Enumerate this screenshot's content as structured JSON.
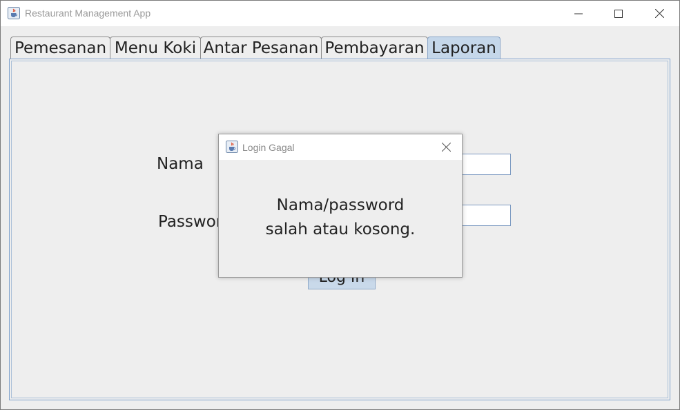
{
  "window": {
    "title": "Restaurant Management App",
    "icon": "java-coffee-icon",
    "controls": [
      "minimize-icon",
      "maximize-icon",
      "close-icon"
    ]
  },
  "tabs": [
    {
      "label": "Pemesanan",
      "active": false
    },
    {
      "label": "Menu Koki",
      "active": false
    },
    {
      "label": "Antar Pesanan",
      "active": false
    },
    {
      "label": "Pembayaran",
      "active": false
    },
    {
      "label": "Laporan",
      "active": true
    }
  ],
  "login_form": {
    "name_label": "Nama",
    "password_label": "Passwor",
    "name_value": "",
    "password_value": "",
    "login_button": "Log In"
  },
  "dialog": {
    "title": "Login Gagal",
    "icon": "java-coffee-icon",
    "message_line1": "Nama/password",
    "message_line2": "salah atau kosong."
  },
  "colors": {
    "active_tab": "#c5d7ea",
    "focus_border": "#7ea1cc",
    "background": "#eeeeee"
  }
}
